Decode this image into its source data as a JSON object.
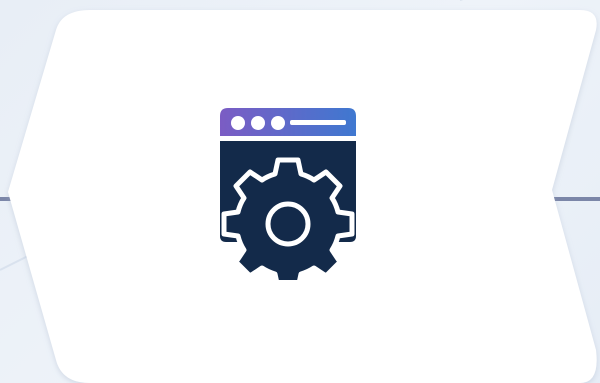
{
  "colors": {
    "background": "#e9eff7",
    "card": "#ffffff",
    "accent_line": "#7b86a8",
    "window_body": "#132a4a",
    "title_bar_start": "#7b5cc4",
    "title_bar_end": "#3f78d0",
    "gear_outline": "#ffffff"
  },
  "icons": {
    "main": "browser-settings-icon",
    "gear": "gear-icon",
    "window_dots": "window-control-dots-icon"
  }
}
